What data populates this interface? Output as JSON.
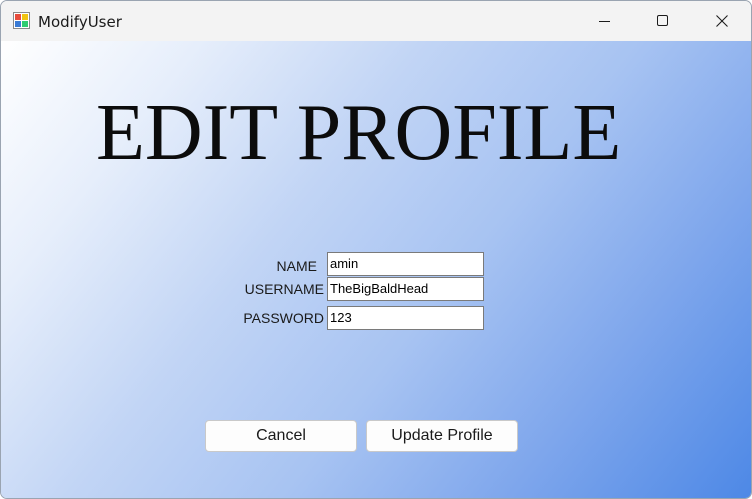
{
  "window": {
    "title": "ModifyUser",
    "controls": {
      "minimize": "minimize-icon",
      "maximize": "maximize-icon",
      "close": "close-icon"
    }
  },
  "form": {
    "heading": "EDIT PROFILE",
    "fields": [
      {
        "label": "NAME",
        "value": "amin"
      },
      {
        "label": "USERNAME",
        "value": "TheBigBaldHead"
      },
      {
        "label": "PASSWORD",
        "value": "123"
      }
    ],
    "buttons": {
      "cancel": "Cancel",
      "update": "Update Profile"
    }
  },
  "colors": {
    "gradient_start": "#ffffff",
    "gradient_end": "#4d88e6",
    "titlebar": "#f3f3f3"
  }
}
